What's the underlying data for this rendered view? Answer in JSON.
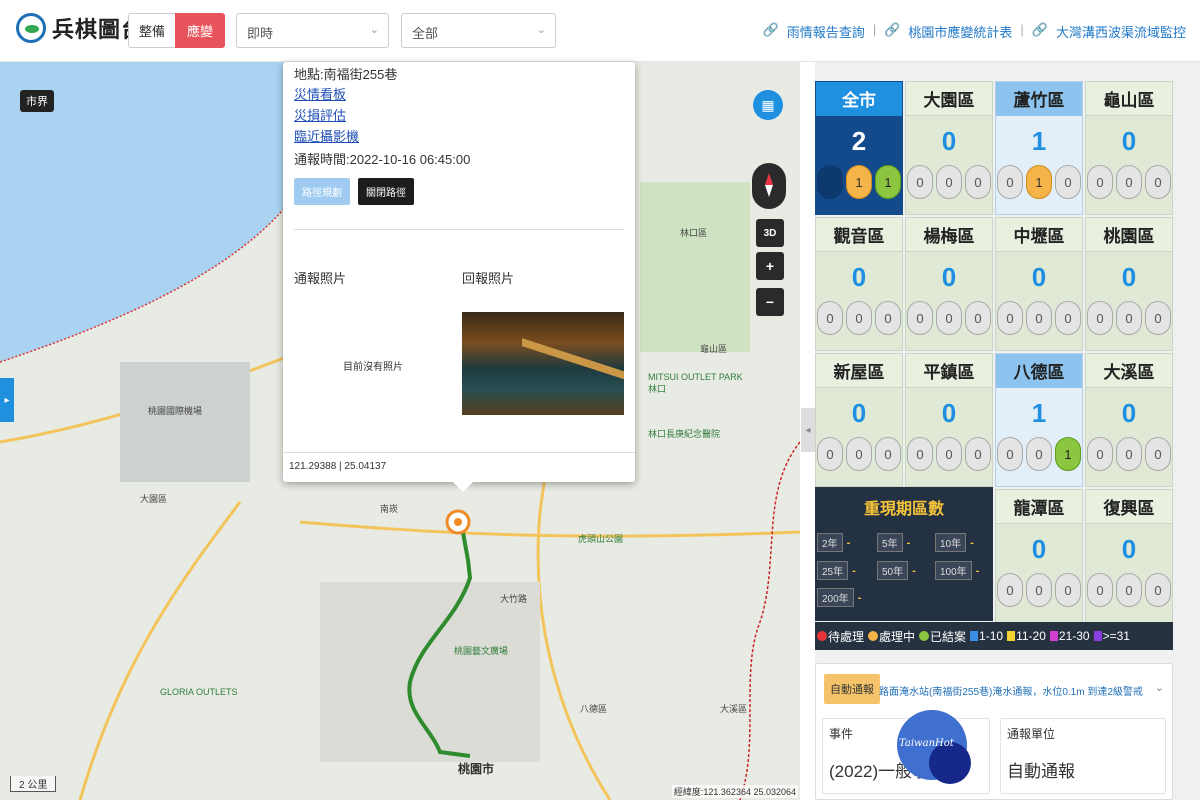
{
  "header": {
    "app_title": "兵棋圖台",
    "mode_buttons": [
      "整備",
      "應變"
    ],
    "time_select": "即時",
    "area_select": "全部",
    "links": [
      "雨情報告查詢",
      "桃園市應變統計表",
      "大灣溝西波渠流域監控"
    ]
  },
  "map": {
    "city_boundary_tag": "市界",
    "scale_label": "2 公里",
    "coordinate_readout": "經緯度:121.362364 25.032064",
    "controls": {
      "three_d": "3D",
      "zoom_in": "+",
      "zoom_out": "−"
    },
    "labels": [
      {
        "text": "大園區",
        "kind": "district"
      },
      {
        "text": "桃園市",
        "kind": "city"
      },
      {
        "text": "林口區",
        "kind": "district"
      },
      {
        "text": "大溪區",
        "kind": "district"
      },
      {
        "text": "GLORIA OUTLETS",
        "kind": "poi"
      },
      {
        "text": "MITSUI OUTLET PARK 林口",
        "kind": "poi"
      },
      {
        "text": "桃園國際機場",
        "kind": "poi"
      },
      {
        "text": "林口長庚紀念醫院",
        "kind": "poi"
      },
      {
        "text": "桃園藝文廣場",
        "kind": "poi"
      },
      {
        "text": "虎頭山公園",
        "kind": "poi"
      },
      {
        "text": "八德區",
        "kind": "district"
      },
      {
        "text": "龜山區",
        "kind": "district"
      },
      {
        "text": "大竹路",
        "kind": "road"
      },
      {
        "text": "南崁",
        "kind": "area"
      }
    ]
  },
  "popup": {
    "location": "地點:南福街255巷",
    "links": [
      "災情看板",
      "災損評估",
      "臨近攝影機"
    ],
    "report_time": "通報時間:2022-10-16 06:45:00",
    "route_button": "路徑規劃",
    "close_route_button": "關閉路徑",
    "report_photo_heading": "通報照片",
    "return_photo_heading": "回報照片",
    "no_photo_text": "目前沒有照片",
    "coordinates": "121.29388 | 25.04137"
  },
  "districts": [
    {
      "name": "全市",
      "total": "2",
      "pending": "0",
      "processing": "1",
      "closed": "1",
      "style": "all"
    },
    {
      "name": "大園區",
      "total": "0",
      "pending": "0",
      "processing": "0",
      "closed": "0",
      "style": "normal"
    },
    {
      "name": "蘆竹區",
      "total": "1",
      "pending": "0",
      "processing": "1",
      "closed": "0",
      "style": "hl"
    },
    {
      "name": "龜山區",
      "total": "0",
      "pending": "0",
      "processing": "0",
      "closed": "0",
      "style": "normal"
    },
    {
      "name": "觀音區",
      "total": "0",
      "pending": "0",
      "processing": "0",
      "closed": "0",
      "style": "normal"
    },
    {
      "name": "楊梅區",
      "total": "0",
      "pending": "0",
      "processing": "0",
      "closed": "0",
      "style": "normal"
    },
    {
      "name": "中壢區",
      "total": "0",
      "pending": "0",
      "processing": "0",
      "closed": "0",
      "style": "normal"
    },
    {
      "name": "桃園區",
      "total": "0",
      "pending": "0",
      "processing": "0",
      "closed": "0",
      "style": "normal"
    },
    {
      "name": "新屋區",
      "total": "0",
      "pending": "0",
      "processing": "0",
      "closed": "0",
      "style": "normal"
    },
    {
      "name": "平鎮區",
      "total": "0",
      "pending": "0",
      "processing": "0",
      "closed": "0",
      "style": "normal"
    },
    {
      "name": "八德區",
      "total": "1",
      "pending": "0",
      "processing": "0",
      "closed": "1",
      "style": "hl"
    },
    {
      "name": "大溪區",
      "total": "0",
      "pending": "0",
      "processing": "0",
      "closed": "0",
      "style": "normal"
    },
    {
      "name": "龍潭區",
      "total": "0",
      "pending": "0",
      "processing": "0",
      "closed": "0",
      "style": "normal"
    },
    {
      "name": "復興區",
      "total": "0",
      "pending": "0",
      "processing": "0",
      "closed": "0",
      "style": "normal"
    }
  ],
  "return_period": {
    "title": "重現期區數",
    "items": [
      {
        "label": "2年",
        "value": "-"
      },
      {
        "label": "5年",
        "value": "-"
      },
      {
        "label": "10年",
        "value": "-"
      },
      {
        "label": "25年",
        "value": "-"
      },
      {
        "label": "50年",
        "value": "-"
      },
      {
        "label": "100年",
        "value": "-"
      },
      {
        "label": "200年",
        "value": "-"
      }
    ]
  },
  "legend": {
    "status": [
      {
        "label": "待處理",
        "color": "#e8353b"
      },
      {
        "label": "處理中",
        "color": "#f5b44a"
      },
      {
        "label": "已結案",
        "color": "#8cc640"
      }
    ],
    "ranges": [
      {
        "label": "1-10",
        "color": "#3a8ee6"
      },
      {
        "label": "11-20",
        "color": "#f3d334"
      },
      {
        "label": "21-30",
        "color": "#d43ed0"
      },
      {
        "label": ">=31",
        "color": "#8a3fe0"
      }
    ]
  },
  "notice": {
    "tag": "自動通報",
    "message": "路面淹水站(南福街255巷)淹水通報，水位0.1m 到達2級警戒",
    "event_label": "事件",
    "event_value": "(2022)一般事件",
    "unit_label": "通報單位",
    "unit_value": "自動通報"
  },
  "watermark": "TaiwanHot",
  "colors": {
    "accent": "#1f8fe0",
    "alert": "#e8545c",
    "route": "#2e8b2e"
  }
}
